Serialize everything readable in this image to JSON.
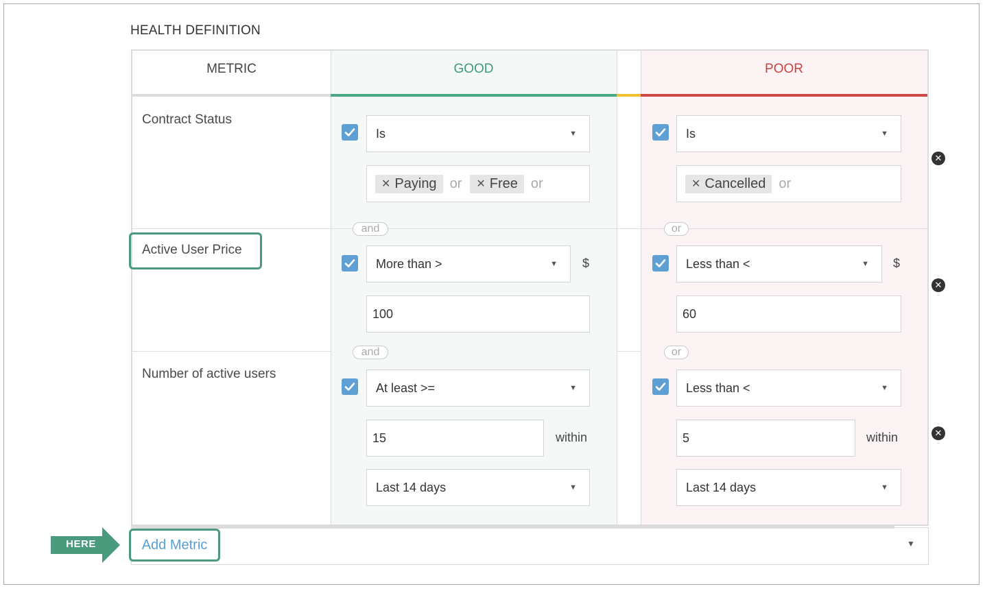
{
  "section_title": "HEALTH DEFINITION",
  "headers": {
    "metric": "METRIC",
    "good": "GOOD",
    "poor": "POOR"
  },
  "colors": {
    "good": "#3d9a79",
    "poor": "#c74343",
    "accent": "#4a9a7e",
    "checkbox": "#5fa0d4",
    "neutral_bar": "#f1c232"
  },
  "connectors": {
    "good": "and",
    "poor": "or"
  },
  "metrics": [
    {
      "name": "Contract Status",
      "good": {
        "checked": true,
        "operator": "Is",
        "tags": [
          "Paying",
          "Free"
        ],
        "tag_joiner": "or"
      },
      "poor": {
        "checked": true,
        "operator": "Is",
        "tags": [
          "Cancelled"
        ],
        "tag_joiner": "or"
      }
    },
    {
      "name": "Active User Price",
      "good": {
        "checked": true,
        "operator": "More than >",
        "unit": "$",
        "value": "100"
      },
      "poor": {
        "checked": true,
        "operator": "Less than <",
        "unit": "$",
        "value": "60"
      }
    },
    {
      "name": "Number of active users",
      "good": {
        "checked": true,
        "operator": "At least >=",
        "value": "15",
        "within_label": "within",
        "period": "Last 14 days"
      },
      "poor": {
        "checked": true,
        "operator": "Less than <",
        "value": "5",
        "within_label": "within",
        "period": "Last 14 days"
      }
    }
  ],
  "add_metric_label": "Add Metric",
  "here_label": "HERE",
  "icons": {
    "caret": "caret-down-icon",
    "check": "check-icon",
    "remove": "close-circle-icon",
    "tag_remove": "x-icon"
  }
}
